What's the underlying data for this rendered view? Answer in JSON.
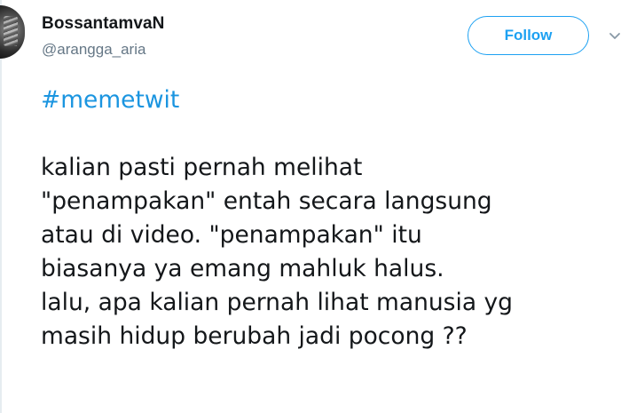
{
  "user": {
    "display_name": "BossantamvaN",
    "handle": "@arangga_aria"
  },
  "actions": {
    "follow_label": "Follow"
  },
  "tweet": {
    "hashtag": "#memetwit",
    "lines": [
      "kalian pasti pernah melihat",
      "\"penampakan\" entah secara langsung",
      "atau di video. \"penampakan\" itu",
      "biasanya ya emang mahluk halus.",
      "lalu, apa kalian pernah lihat manusia yg",
      "masih hidup berubah jadi pocong ??"
    ]
  },
  "icons": {
    "avatar": "avatar-image",
    "caret": "chevron-down-icon"
  },
  "colors": {
    "accent": "#1da1f2",
    "hashtag": "#1b95e0",
    "text": "#14171a",
    "secondary": "#657786"
  }
}
